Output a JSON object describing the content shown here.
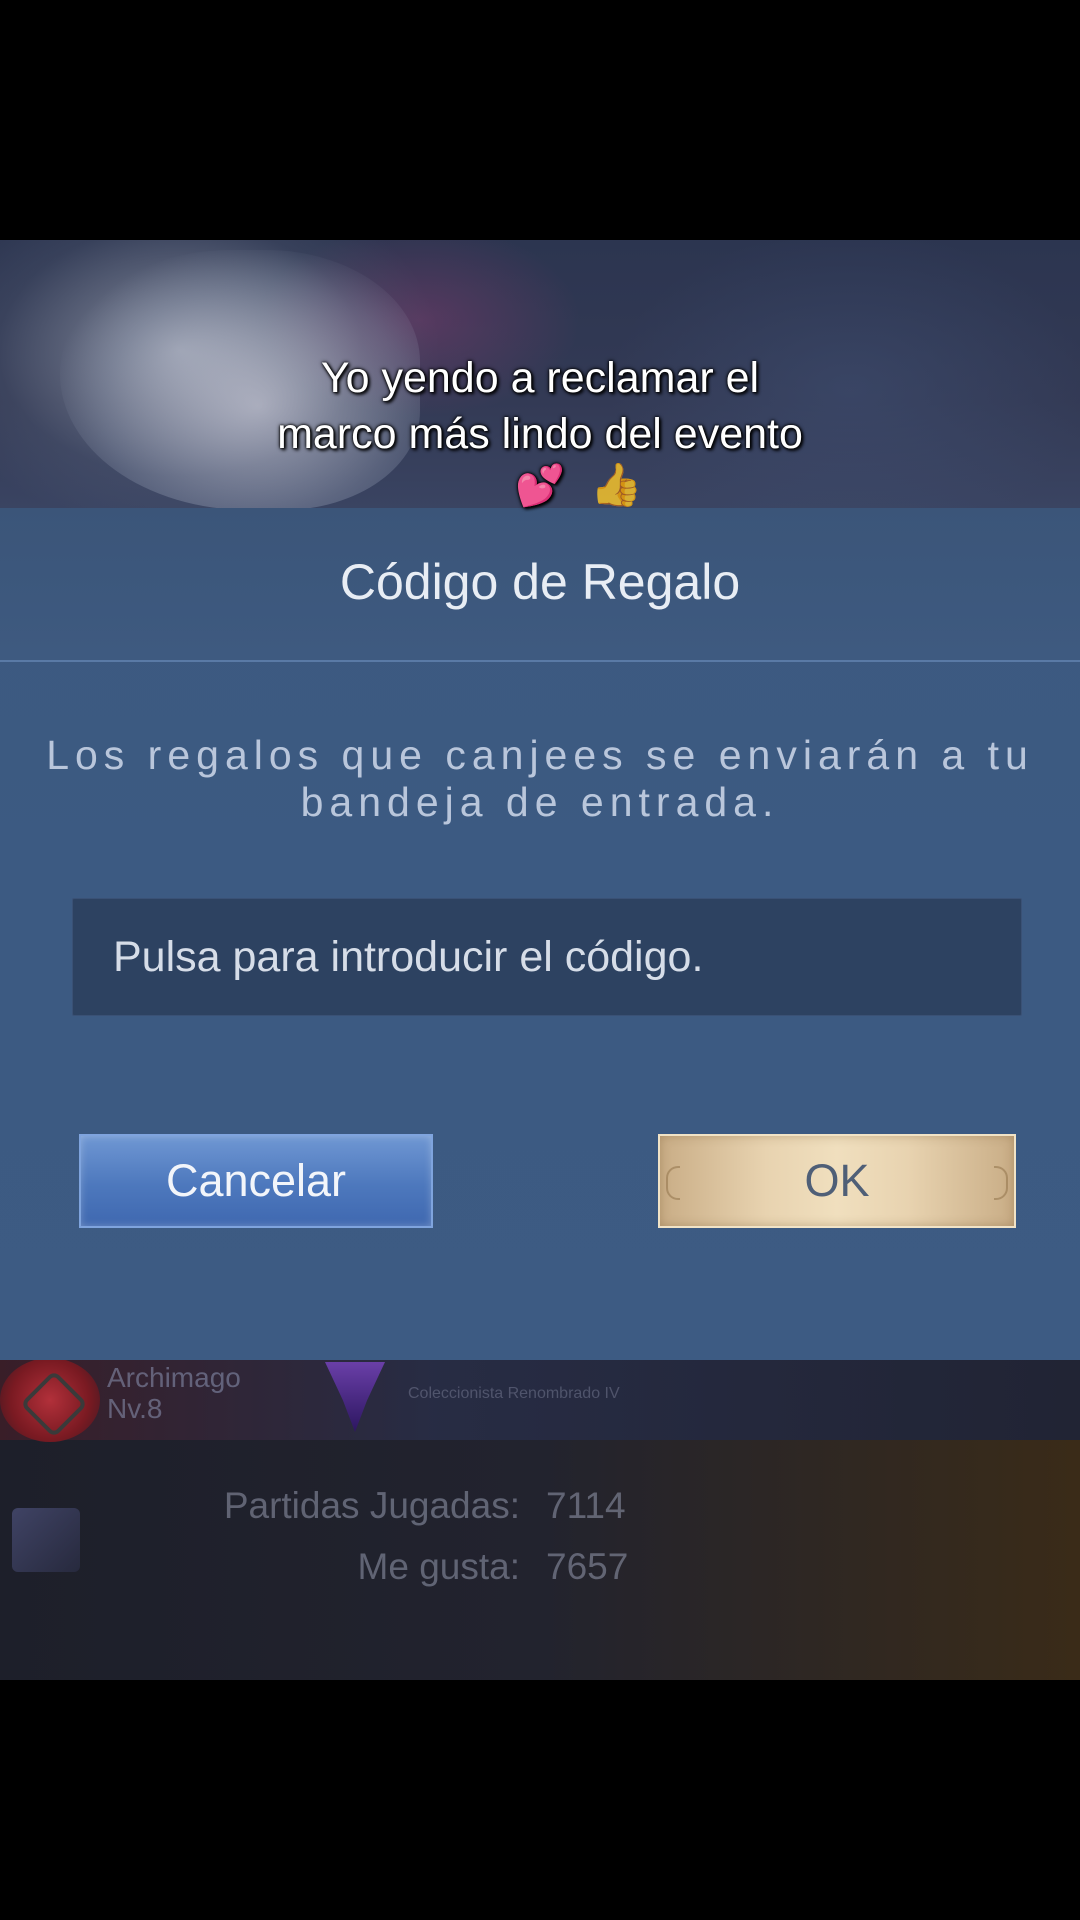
{
  "caption": {
    "line1": "Yo yendo a reclamar el",
    "line2": "marco más lindo del evento",
    "emoji": "💕"
  },
  "dialog": {
    "title": "Código de Regalo",
    "message": "Los regalos que canjees se enviarán a tu bandeja de entrada.",
    "input_placeholder": "Pulsa para introducir el código.",
    "input_value": "",
    "cancel_label": "Cancelar",
    "ok_label": "OK"
  },
  "profile_background": {
    "rank_name": "Archimago",
    "rank_level": "Nv.8",
    "title": "Coleccionista Renombrado IV",
    "matches_label": "Partidas Jugadas:",
    "matches_value": "7114",
    "likes_label": "Me gusta:",
    "likes_value": "7657"
  },
  "icons": {
    "thumb": "thumbs-up-icon",
    "rank": "rank-badge-icon",
    "emblem": "collector-emblem-icon"
  }
}
